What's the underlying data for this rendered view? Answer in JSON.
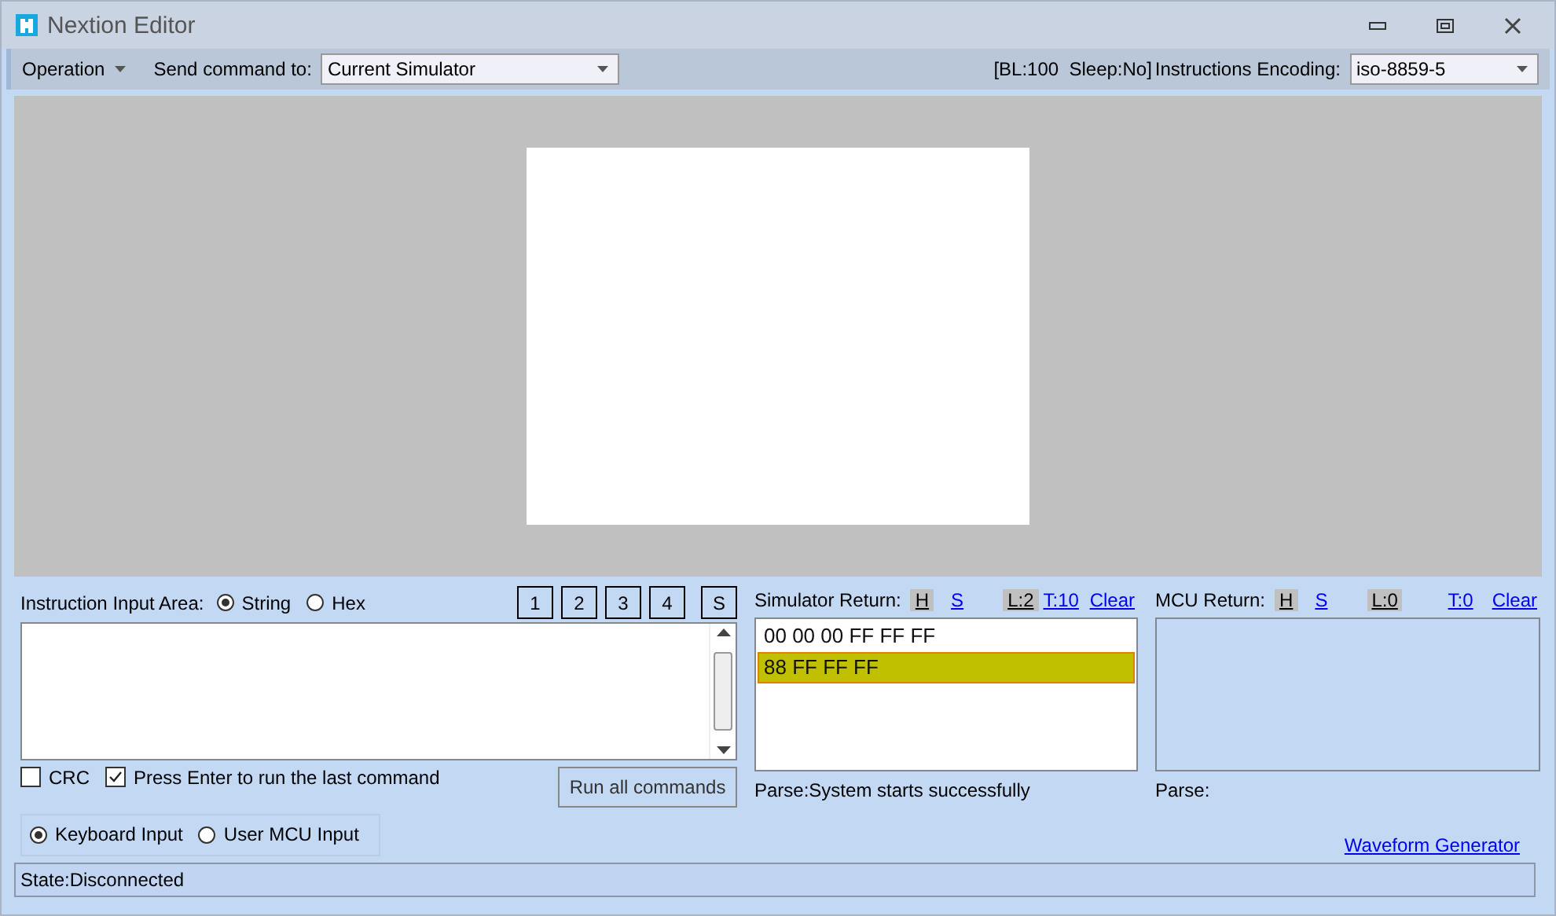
{
  "window": {
    "title": "Nextion Editor"
  },
  "toolbar": {
    "menu": "Operation",
    "send_label": "Send command to:",
    "send_target": "Current Simulator",
    "status": "[BL:100  Sleep:No]",
    "encoding_label": "Instructions Encoding:",
    "encoding": "iso-8859-5"
  },
  "input_area": {
    "label": "Instruction Input Area:",
    "modes": [
      {
        "label": "String",
        "selected": true
      },
      {
        "label": "Hex",
        "selected": false
      }
    ],
    "slots": [
      "1",
      "2",
      "3",
      "4",
      "S"
    ]
  },
  "options": [
    {
      "label": "CRC",
      "checked": false
    },
    {
      "label": "Press Enter to run the last command",
      "checked": true
    }
  ],
  "run_button": "Run all commands",
  "input_sources": [
    {
      "label": "Keyboard Input",
      "selected": true
    },
    {
      "label": "User MCU Input",
      "selected": false
    }
  ],
  "simulator_return": {
    "title": "Simulator Return:",
    "toggles": [
      {
        "label": "H",
        "selected": true
      },
      {
        "label": "S",
        "selected": false
      },
      {
        "label": "L:2",
        "selected": true
      },
      {
        "label": "T:10",
        "selected": false
      }
    ],
    "clear": "Clear",
    "lines": [
      {
        "text": "00 00 00 FF FF FF",
        "selected": false
      },
      {
        "text": "88 FF FF FF",
        "selected": true
      }
    ],
    "parse": "Parse:System starts successfully"
  },
  "mcu_return": {
    "title": "MCU Return:",
    "toggles": [
      {
        "label": "H",
        "selected": true
      },
      {
        "label": "S",
        "selected": false
      },
      {
        "label": "L:0",
        "selected": true
      },
      {
        "label": "T:0",
        "selected": false
      }
    ],
    "clear": "Clear",
    "parse": "Parse:"
  },
  "waveform_link": "Waveform Generator",
  "status_bar": "State:Disconnected"
}
